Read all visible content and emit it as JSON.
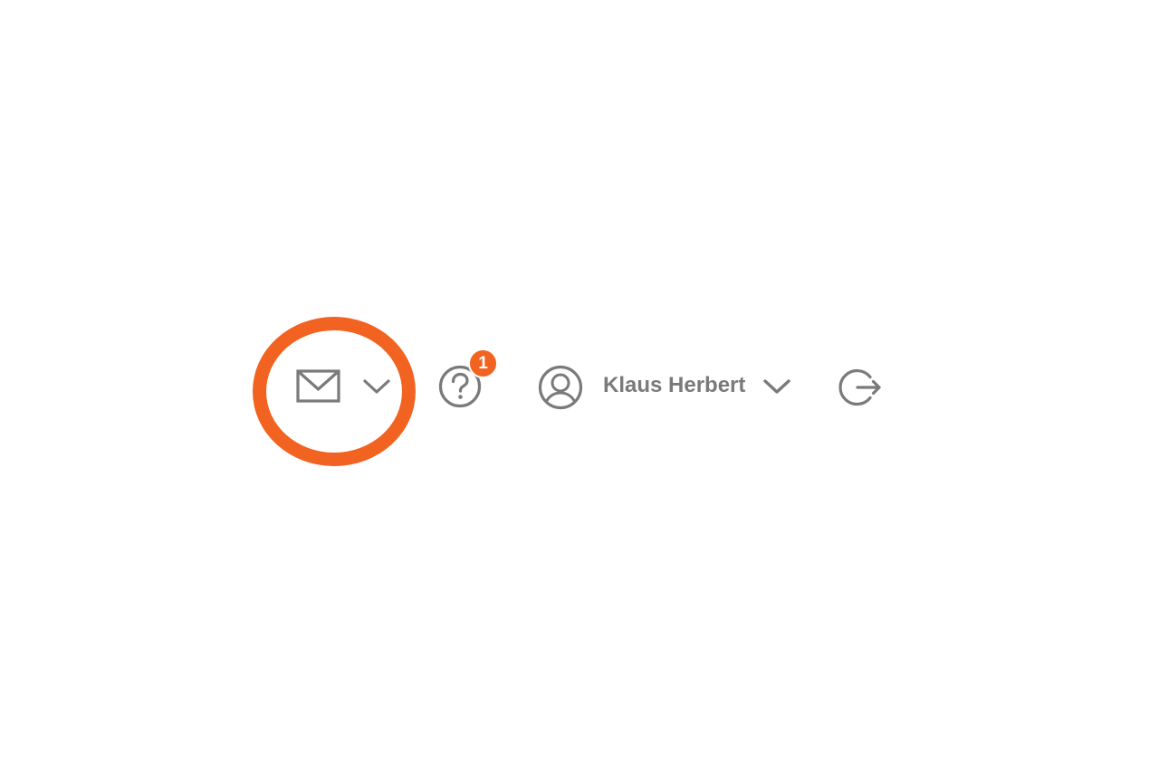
{
  "header": {
    "mail": {
      "icon": "envelope-icon",
      "dropdown_icon": "chevron-down-icon"
    },
    "help": {
      "icon": "question-circle-icon",
      "badge_count": "1"
    },
    "user": {
      "avatar_icon": "user-circle-icon",
      "name": "Klaus Herbert",
      "dropdown_icon": "chevron-down-icon"
    },
    "logout": {
      "icon": "logout-icon"
    }
  },
  "annotation": {
    "highlight": "mail",
    "shape": "ellipse"
  },
  "colors": {
    "accent": "#f26322",
    "icon": "#7a7a7a",
    "background": "#ffffff"
  }
}
